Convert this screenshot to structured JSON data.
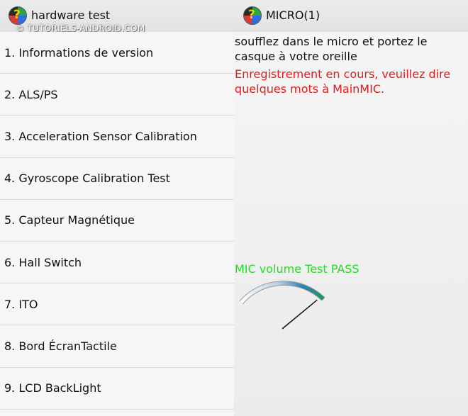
{
  "left_pane": {
    "title": "hardware test",
    "icon": "hardware-test-app-icon",
    "watermark": "© TUTORIELS-ANDROID.COM",
    "items": [
      {
        "label": "1. Informations de version"
      },
      {
        "label": "2. ALS/PS"
      },
      {
        "label": "3. Acceleration Sensor Calibration"
      },
      {
        "label": "4. Gyroscope Calibration Test"
      },
      {
        "label": "5. Capteur Magnétique"
      },
      {
        "label": "6. Hall Switch"
      },
      {
        "label": "7. ITO"
      },
      {
        "label": "8. Bord ÉcranTactile"
      },
      {
        "label": "9. LCD BackLight"
      }
    ]
  },
  "right_pane": {
    "title": "MICRO(1)",
    "icon": "hardware-test-app-icon",
    "instruction": "soufflez dans le micro et portez le casque à votre oreille",
    "recording_status": "Enregistrement en cours, veuillez dire quelques mots à MainMIC.",
    "result": "MIC volume Test PASS",
    "colors": {
      "recording_status": "#e21b1b",
      "result": "#22dd22",
      "gauge_high": "#1f9a5a"
    },
    "gauge": {
      "level": 0.78
    }
  }
}
